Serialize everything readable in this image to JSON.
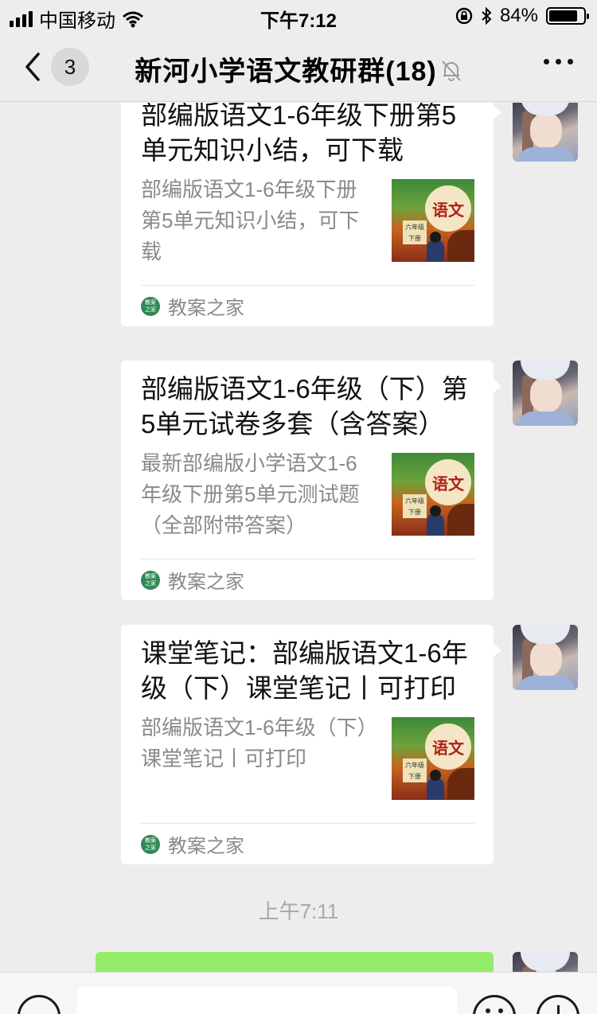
{
  "status_bar": {
    "carrier": "中国移动",
    "time": "下午7:12",
    "battery": "84%",
    "battery_level": 0.84
  },
  "header": {
    "back_count": "3",
    "title": "新河小学语文教研群(18)"
  },
  "messages": [
    {
      "title": "部编版语文1-6年级下册第5单元知识小结，可下载",
      "desc": "部编版语文1-6年级下册第5单元知识小结，可下载",
      "source": "教案之家",
      "thumb_label": "语文",
      "thumb_grade": "六年级 下册"
    },
    {
      "title": "部编版语文1-6年级（下）第5单元试卷多套（含答案）",
      "desc": "最新部编版小学语文1-6年级下册第5单元测试题（全部附带答案）",
      "source": "教案之家",
      "thumb_label": "语文",
      "thumb_grade": "六年级 下册"
    },
    {
      "title": "课堂笔记：部编版语文1-6年级（下）课堂笔记丨可打印",
      "desc": "部编版语文1-6年级（下）课堂笔记丨可打印",
      "source": "教案之家",
      "thumb_label": "语文",
      "thumb_grade": "六年级 下册"
    }
  ],
  "timestamp": "上午7:11",
  "colors": {
    "background": "#ededed",
    "bubble_self": "#95ec69",
    "source_icon": "#2f8a55"
  },
  "icons": {
    "back": "chevron-left-icon",
    "mute": "bell-off-icon",
    "more": "more-dots-icon",
    "voice": "voice-icon",
    "emoji": "emoji-icon",
    "plus": "plus-icon"
  }
}
